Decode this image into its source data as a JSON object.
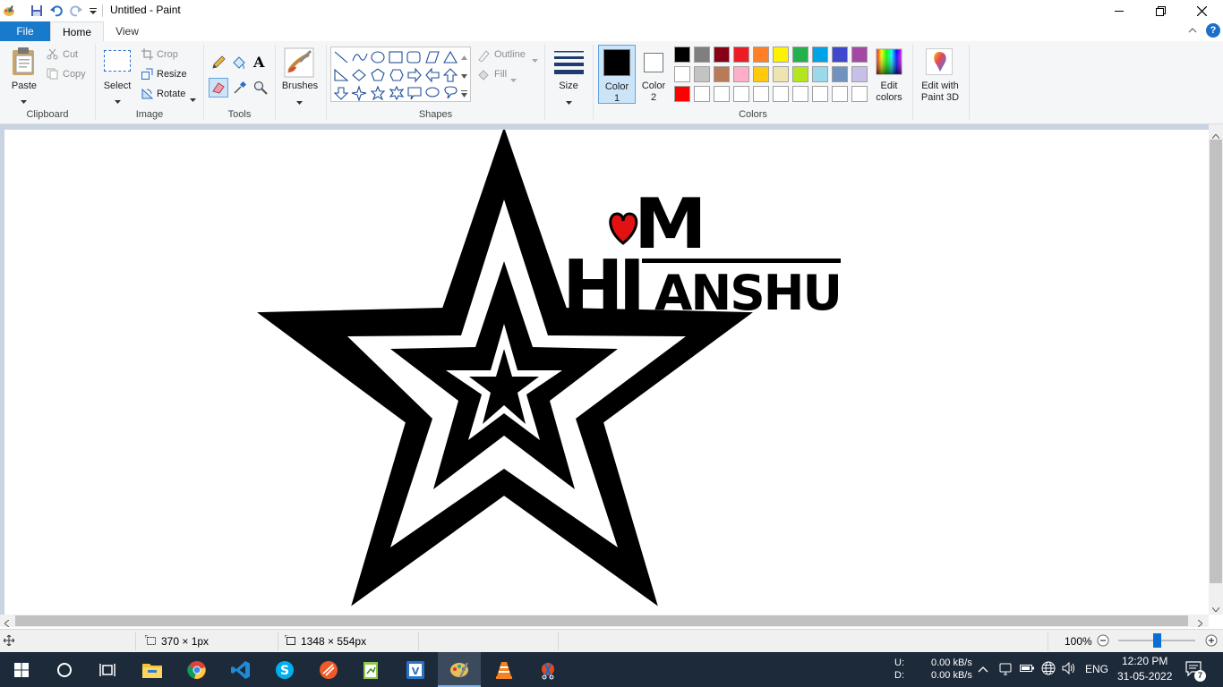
{
  "window": {
    "title": "Untitled - Paint"
  },
  "tabs": {
    "file": "File",
    "home": "Home",
    "view": "View"
  },
  "clipboard": {
    "paste": "Paste",
    "cut": "Cut",
    "copy": "Copy",
    "label": "Clipboard"
  },
  "image": {
    "select": "Select",
    "crop": "Crop",
    "resize": "Resize",
    "rotate": "Rotate",
    "label": "Image"
  },
  "tools": {
    "label": "Tools"
  },
  "brushes": {
    "label": "Brushes"
  },
  "shapes": {
    "outline": "Outline",
    "fill": "Fill",
    "label": "Shapes"
  },
  "size": {
    "label": "Size"
  },
  "colors": {
    "color1_label": "Color",
    "color1_num": "1",
    "color2_label": "Color",
    "color2_num": "2",
    "label": "Colors",
    "edit_colors_line1": "Edit",
    "edit_colors_line2": "colors",
    "palette_row1": [
      "#000000",
      "#7f7f7f",
      "#880015",
      "#ed1c24",
      "#ff7f27",
      "#fff200",
      "#22b14c",
      "#00a2e8",
      "#3f48cc",
      "#a349a4"
    ],
    "palette_row2": [
      "#ffffff",
      "#c3c3c3",
      "#b97a57",
      "#ffaec9",
      "#ffc90e",
      "#efe4b0",
      "#b5e61d",
      "#99d9ea",
      "#7092be",
      "#c8bfe7"
    ],
    "palette_row3": [
      "#ff0000",
      "#ffffff",
      "#ffffff",
      "#ffffff",
      "#ffffff",
      "#ffffff",
      "#ffffff",
      "#ffffff",
      "#ffffff",
      "#ffffff"
    ]
  },
  "paint3d": {
    "line1": "Edit with",
    "line2": "Paint 3D"
  },
  "drawing": {
    "text_m": "M",
    "text_hi": "HI",
    "text_anshu": "ANSHU"
  },
  "status": {
    "selection_size": "370 × 1px",
    "image_size": "1348 × 554px",
    "zoom": "100%"
  },
  "taskbar": {
    "net_up_label": "U:",
    "net_down_label": "D:",
    "net_up": "0.00 kB/s",
    "net_down": "0.00 kB/s",
    "language": "ENG",
    "time": "12:20 PM",
    "date": "31-05-2022",
    "notifications": "7"
  }
}
